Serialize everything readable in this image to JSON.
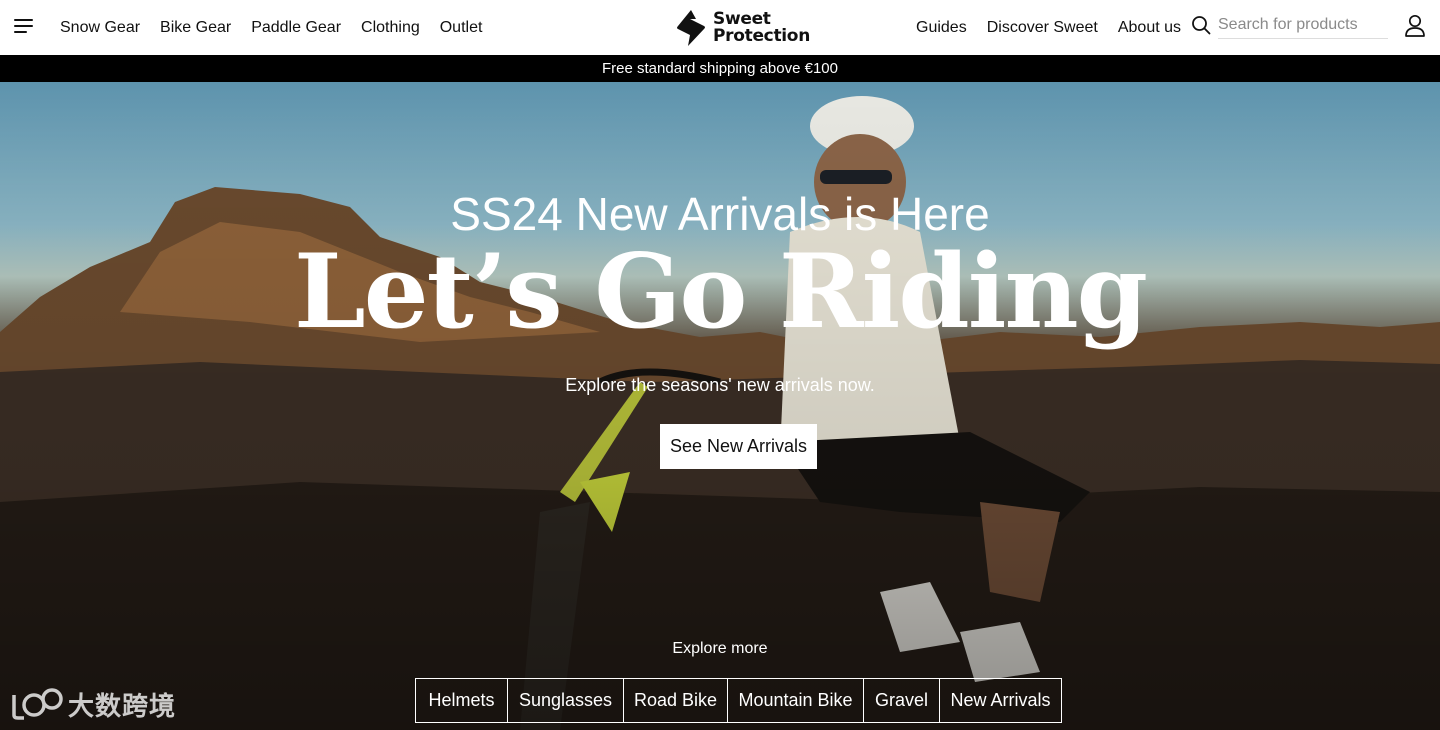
{
  "header": {
    "menu_icon": "hamburger-menu-icon",
    "nav_left": [
      "Snow Gear",
      "Bike Gear",
      "Paddle Gear",
      "Clothing",
      "Outlet"
    ],
    "logo": {
      "line1": "Sweet",
      "line2": "Protection"
    },
    "nav_right": [
      "Guides",
      "Discover Sweet",
      "About us"
    ],
    "search": {
      "icon": "search-icon",
      "placeholder": "Search for products"
    },
    "account_icon": "user-icon"
  },
  "announcement": "Free standard shipping above €100",
  "hero": {
    "subtitle": "SS24 New Arrivals is Here",
    "title": "Let’s Go Riding",
    "description": "Explore the seasons' new arrivals now.",
    "cta_label": "See New Arrivals",
    "explore_label": "Explore more",
    "categories": [
      "Helmets",
      "Sunglasses",
      "Road Bike",
      "Mountain Bike",
      "Gravel",
      "New Arrivals"
    ]
  },
  "watermark": {
    "text": "大数跨境"
  }
}
